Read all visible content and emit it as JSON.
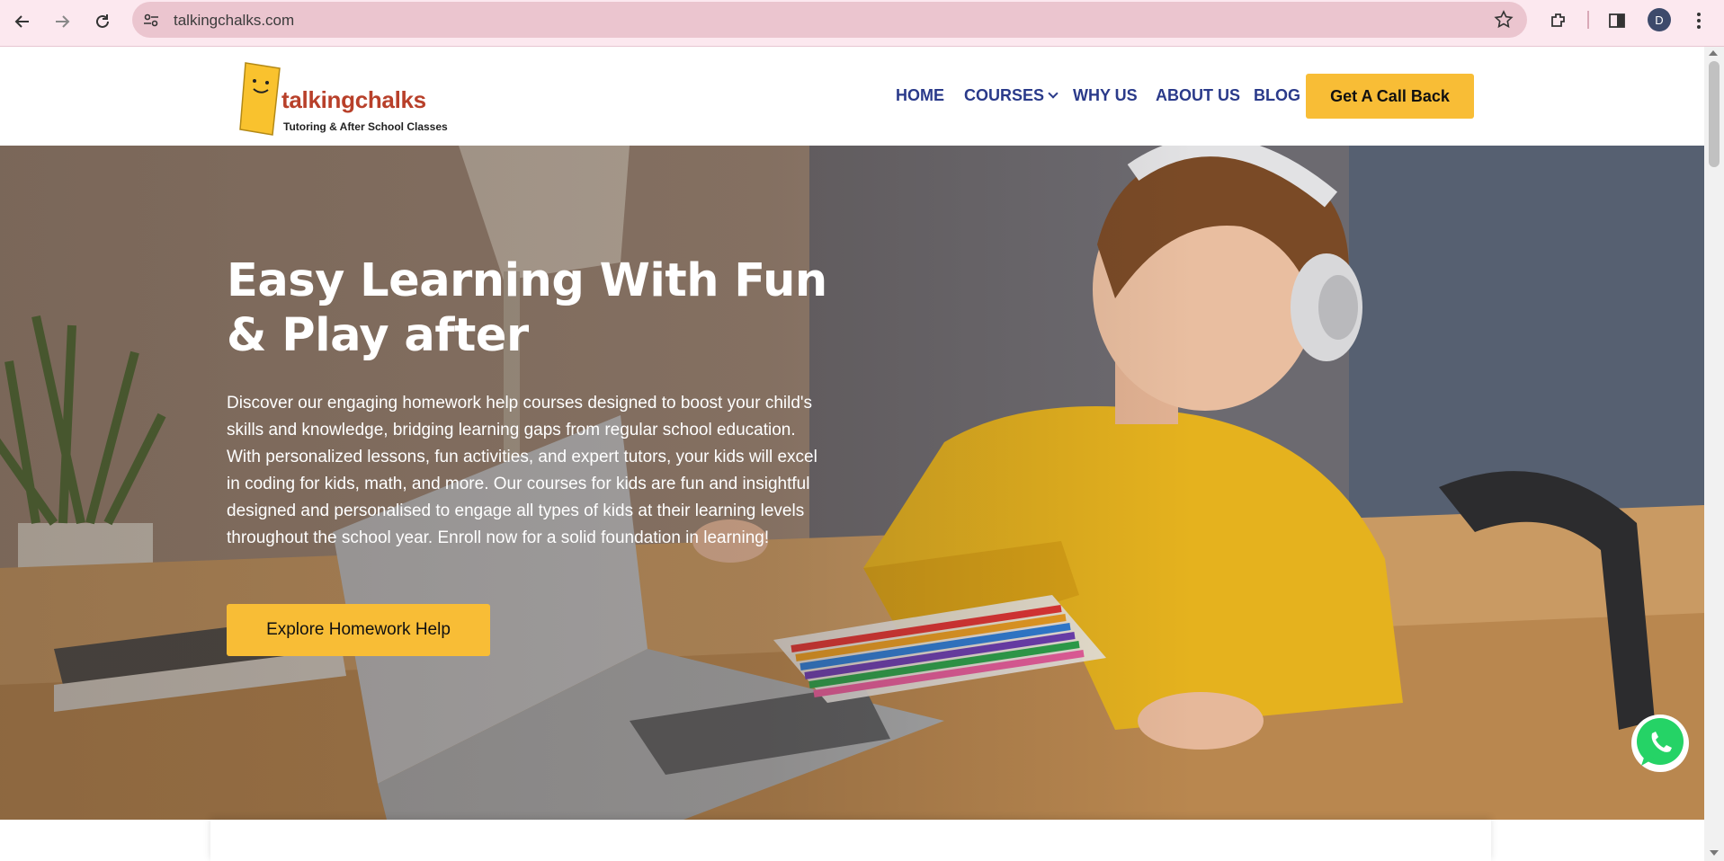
{
  "browser": {
    "url": "talkingchalks.com",
    "profile_initial": "D",
    "icons": [
      "back-arrow-icon",
      "forward-arrow-icon",
      "reload-icon",
      "site-info-icon",
      "bookmark-star-icon",
      "extensions-icon",
      "side-panel-icon",
      "more-menu-icon"
    ]
  },
  "header": {
    "logo_title": "talkingchalks",
    "logo_subtitle": "Tutoring & After School Classes",
    "nav": {
      "home": "HOME",
      "courses": "COURSES",
      "why_us": "WHY US",
      "about_us": "ABOUT US",
      "blog": "BLOG"
    },
    "cta_label": "Get A Call Back"
  },
  "hero": {
    "title": "Easy Learning With Fun & Play after",
    "description": "Discover our engaging homework help courses designed to boost your child's skills and knowledge, bridging learning gaps from regular school education. With personalized lessons, fun activities, and expert tutors, your kids will excel in coding for kids, math, and more. Our courses for kids are fun and insightful designed and personalised to engage all types of kids at their learning levels throughout the school year. Enroll now for a solid foundation in learning!",
    "button_label": "Explore Homework Help"
  },
  "colors": {
    "accent": "#f8bd36",
    "nav_text": "#2a3a8a",
    "logo_red": "#b8402a",
    "whatsapp_green": "#25d366"
  }
}
